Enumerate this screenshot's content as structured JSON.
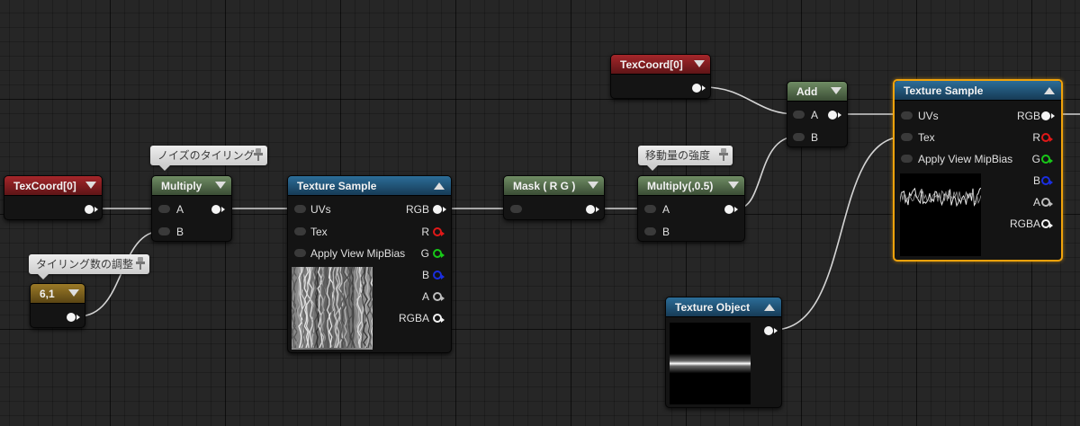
{
  "nodes": {
    "texcoord_left": {
      "title": "TexCoord[0]",
      "color": "#8f2226"
    },
    "texcoord_top": {
      "title": "TexCoord[0]",
      "color": "#8f2226"
    },
    "multiply_tiling": {
      "title": "Multiply",
      "pin_a": "A",
      "pin_b": "B",
      "color": "#5c7552"
    },
    "constant_tiling": {
      "title": "6,1",
      "color": "#8a6c22"
    },
    "texture_sample_noise": {
      "title": "Texture Sample",
      "color": "#245a80",
      "inputs": [
        "UVs",
        "Tex",
        "Apply View MipBias"
      ],
      "outputs": [
        "RGB",
        "R",
        "G",
        "B",
        "A",
        "RGBA"
      ]
    },
    "mask": {
      "title": "Mask ( R G )",
      "color": "#5c7552"
    },
    "multiply_strength": {
      "title": "Multiply(,0.5)",
      "pin_a": "A",
      "pin_b": "B",
      "color": "#5c7552"
    },
    "add": {
      "title": "Add",
      "pin_a": "A",
      "pin_b": "B",
      "color": "#5c7552"
    },
    "texture_sample_main": {
      "title": "Texture Sample",
      "color": "#245a80",
      "selected": true,
      "inputs": [
        "UVs",
        "Tex",
        "Apply View MipBias"
      ],
      "outputs": [
        "RGB",
        "R",
        "G",
        "B",
        "A",
        "RGBA"
      ]
    },
    "texture_object": {
      "title": "Texture Object",
      "color": "#245a80"
    }
  },
  "comments": {
    "noise_tiling": "ノイズのタイリング",
    "tiling_count": "タイリング数の調整",
    "move_strength": "移動量の強度"
  },
  "pin_colors": {
    "R": "#e01818",
    "G": "#18c818",
    "B": "#1a2ee0",
    "A": "#bdbdbd",
    "RGB": "#f4f4f4"
  },
  "selection_color": "#f0a20b",
  "icons": [
    "collapse-chevron-icon",
    "expand-chevron-icon",
    "pushpin-icon"
  ]
}
